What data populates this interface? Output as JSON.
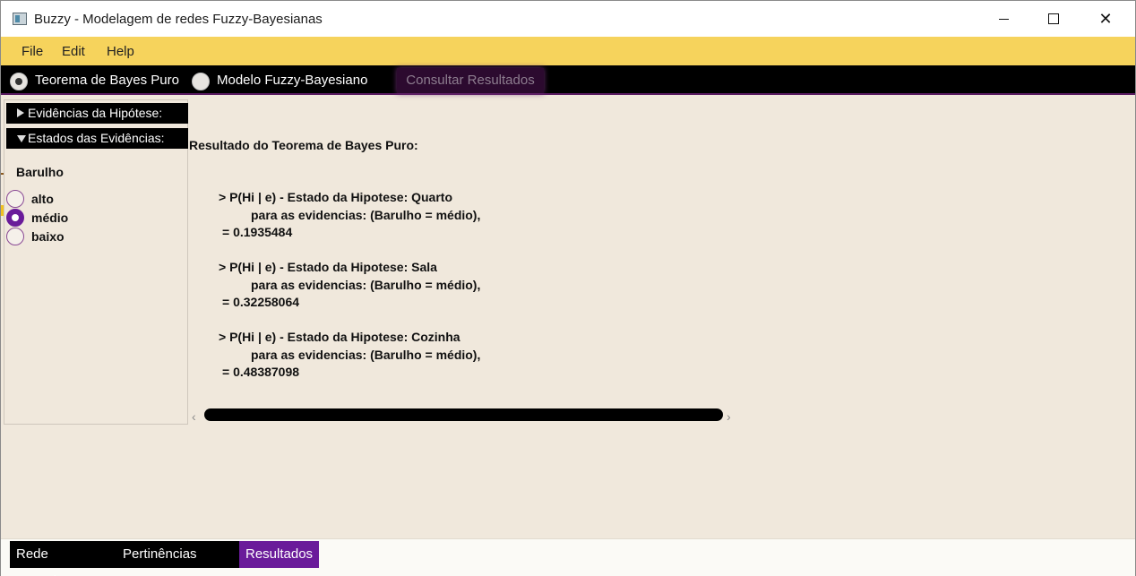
{
  "window": {
    "title": "Buzzy - Modelagem de redes Fuzzy-Bayesianas",
    "controls": {
      "minimize": "minimize-icon",
      "maximize": "maximize-icon",
      "close": "close-icon"
    }
  },
  "menu": {
    "items": [
      "File",
      "Edit",
      "Help"
    ]
  },
  "mode_bar": {
    "options": [
      {
        "label": "Teorema de Bayes Puro",
        "selected": true
      },
      {
        "label": "Modelo Fuzzy-Bayesiano",
        "selected": false
      }
    ],
    "consult_button": "Consultar Resultados"
  },
  "left_panel": {
    "sections": [
      {
        "label": "Evidências da Hipótese:",
        "expanded": false
      },
      {
        "label": "Estados das Evidências:",
        "expanded": true
      }
    ],
    "node": {
      "name": "Barulho",
      "states": [
        {
          "label": "alto",
          "selected": false
        },
        {
          "label": "médio",
          "selected": true
        },
        {
          "label": "baixo",
          "selected": false
        }
      ]
    }
  },
  "results": {
    "title": "Resultado do Teorema de Bayes Puro:",
    "entries": [
      {
        "header": "> P(Hi | e) - Estado da Hipotese: Quarto",
        "evidence": "para as evidencias: (Barulho = médio),",
        "value": "= 0.1935484"
      },
      {
        "header": "> P(Hi | e) - Estado da Hipotese: Sala",
        "evidence": "para as evidencias: (Barulho = médio),",
        "value": "= 0.32258064"
      },
      {
        "header": "> P(Hi | e) - Estado da Hipotese: Cozinha",
        "evidence": "para as evidencias: (Barulho = médio),",
        "value": "= 0.48387098"
      }
    ]
  },
  "tabs": [
    {
      "label": "Rede Bayesiana",
      "active": false
    },
    {
      "label": "Pertinências Fuzzy",
      "active": false
    },
    {
      "label": "Resultados",
      "active": true
    }
  ],
  "colors": {
    "menu_bg": "#f6d35c",
    "accent": "#6a1b9a",
    "content_bg": "#f0e8dc"
  }
}
